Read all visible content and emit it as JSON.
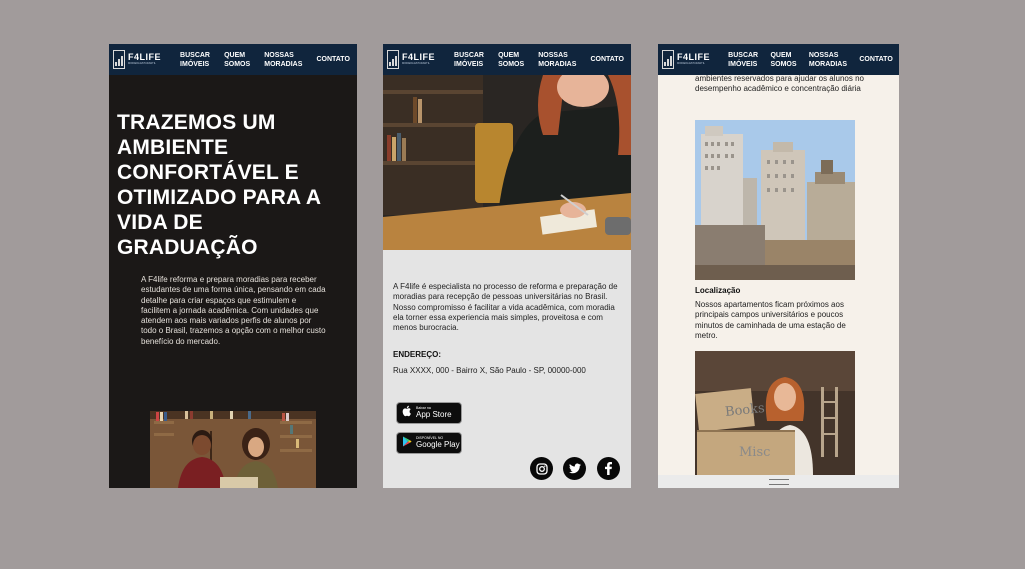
{
  "nav": {
    "logo_name": "F4LIFE",
    "logo_sub": "MORADIA ESTUDANTIL",
    "items": [
      {
        "label": "BUSCAR IMÓVEIS"
      },
      {
        "label": "QUEM SOMOS"
      },
      {
        "label": "NOSSAS MORADIAS"
      },
      {
        "label": "CONTATO"
      }
    ]
  },
  "screen1": {
    "title": "TRAZEMOS UM AMBIENTE CONFORTÁVEL E OTIMIZADO PARA A VIDA DE GRADUAÇÃO",
    "body": "A F4life reforma e prepara moradias para receber estudantes de uma forma única, pensando em cada detalhe para criar espaços que estimulem e facilitem a jornada acadêmica. Com unidades que atendem aos mais variados perfis de alunos por todo o Brasil, trazemos a opção com o melhor custo benefício do mercado."
  },
  "screen2": {
    "body": "A F4life é especialista no processo de reforma e preparação de moradias para recepção de pessoas universitárias no Brasil. Nosso compromisso é facilitar a vida acadêmica, com moradia ela torner essa experiencia mais simples, proveitosa e com menos burocracia.",
    "address_label": "ENDEREÇO:",
    "address_value": "Rua XXXX, 000 - Bairro X, São Paulo - SP, 00000-000",
    "app_store_small": "Baixar na",
    "app_store_big": "App Store",
    "google_play_small": "DISPONÍVEL NO",
    "google_play_big": "Google Play"
  },
  "screen3": {
    "top_text": "ambientes reservados para ajudar os alunos no desempenho acadêmico e concentração diária",
    "location_title": "Localização",
    "location_body": "Nossos apartamentos ficam próximos aos principais campos universitários e poucos minutos de caminhada de uma estação de metro.",
    "box_label_1": "Books",
    "box_label_2": "Misc"
  },
  "colors": {
    "page_bg": "#a19b9b",
    "nav_bg": "#10253d",
    "screen1_bg": "#1b1817",
    "screen2_bg": "#e4e4e4",
    "screen3_bg": "#f6f1ea"
  },
  "icons": {
    "social": [
      "instagram-icon",
      "twitter-icon",
      "facebook-icon"
    ]
  }
}
